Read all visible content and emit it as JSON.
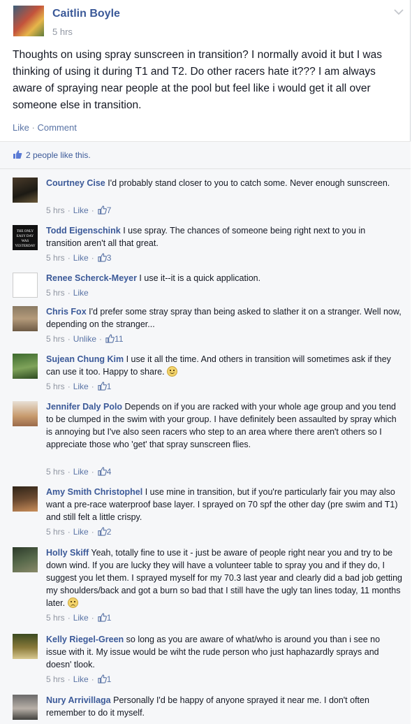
{
  "post": {
    "author": "Caitlin Boyle",
    "time": "5 hrs",
    "text": "Thoughts on using spray sunscreen in transition? I normally avoid it but I was thinking of using it during T1 and T2. Do other racers hate it??? I am always aware of spraying near people at the pool but feel like i would get it all over someone else in transition.",
    "actions": {
      "like": "Like",
      "separator": "·",
      "comment": "Comment"
    }
  },
  "likes": {
    "text": "2 people like this."
  },
  "comments": [
    {
      "name": "Courtney Cise",
      "text": "I'd probably stand closer to you to catch some. Never enough sunscreen.",
      "time": "5 hrs",
      "action": "Like",
      "likes": "7",
      "emoji": ""
    },
    {
      "name": "Todd Eigenschink",
      "text": "I use spray. The chances of someone being right next to you in transition aren't all that great.",
      "time": "5 hrs",
      "action": "Like",
      "likes": "3",
      "emoji": "",
      "avatar_text": "THE ONLY EASY DAY WAS YESTERDAY"
    },
    {
      "name": "Renee Scherck-Meyer",
      "text": "I use it--it is a quick application.",
      "time": "5 hrs",
      "action": "Like",
      "likes": "",
      "emoji": ""
    },
    {
      "name": "Chris Fox",
      "text": "I'd prefer some stray spray than being asked to slather it on a stranger. Well now, depending on the stranger...",
      "time": "5 hrs",
      "action": "Unlike",
      "likes": "11",
      "emoji": ""
    },
    {
      "name": "Sujean Chung Kim",
      "text": "I use it all the time. And others in transition will sometimes ask if they can use it too. Happy to share.",
      "time": "5 hrs",
      "action": "Like",
      "likes": "1",
      "emoji": "smile"
    },
    {
      "name": "Jennifer Daly Polo",
      "text": "Depends on if you are racked with your whole age group and you tend to be clumped in the swim with your group. I have definitely been assaulted by spray which is annoying but I've also seen racers who step to an area where there aren't others so I appreciate those who 'get' that spray sunscreen flies.",
      "time": "5 hrs",
      "action": "Like",
      "likes": "4",
      "emoji": ""
    },
    {
      "name": "Amy Smith Christophel",
      "text": "I use mine in transition, but if you're particularly fair you may also want a pre-race waterproof base layer. I sprayed on 70 spf the other day (pre swim and T1) and still felt a little crispy.",
      "time": "5 hrs",
      "action": "Like",
      "likes": "2",
      "emoji": ""
    },
    {
      "name": "Holly Skiff",
      "text": "Yeah, totally fine to use it - just be aware of people right near you and try to be down wind. If you are lucky they will have a volunteer table to spray you and if they do, I suggest you let them. I sprayed myself for my 70.3 last year and clearly did a bad job getting my shoulders/back and got a burn so bad that I still have the ugly tan lines today, 11 months later.",
      "time": "5 hrs",
      "action": "Like",
      "likes": "1",
      "emoji": "frown"
    },
    {
      "name": "Kelly Riegel-Green",
      "text": "so long as you are aware of what/who is around you than i see no issue with it. My issue would be wiht the rude person who just haphazardly sprays and doesn' tlook.",
      "time": "5 hrs",
      "action": "Like",
      "likes": "1",
      "emoji": ""
    },
    {
      "name": "Nury Arrivillaga",
      "text": "Personally I'd be happy of anyone sprayed it near me. I don't often remember to do it myself.",
      "time": "",
      "action": "",
      "likes": "",
      "emoji": ""
    }
  ],
  "colors": {
    "link": "#3b5998",
    "meta": "#9197a3",
    "comments_bg": "#f6f7f9"
  },
  "icons": {
    "chevron": "chevron-down-icon",
    "thumb": "thumbs-up-icon"
  }
}
